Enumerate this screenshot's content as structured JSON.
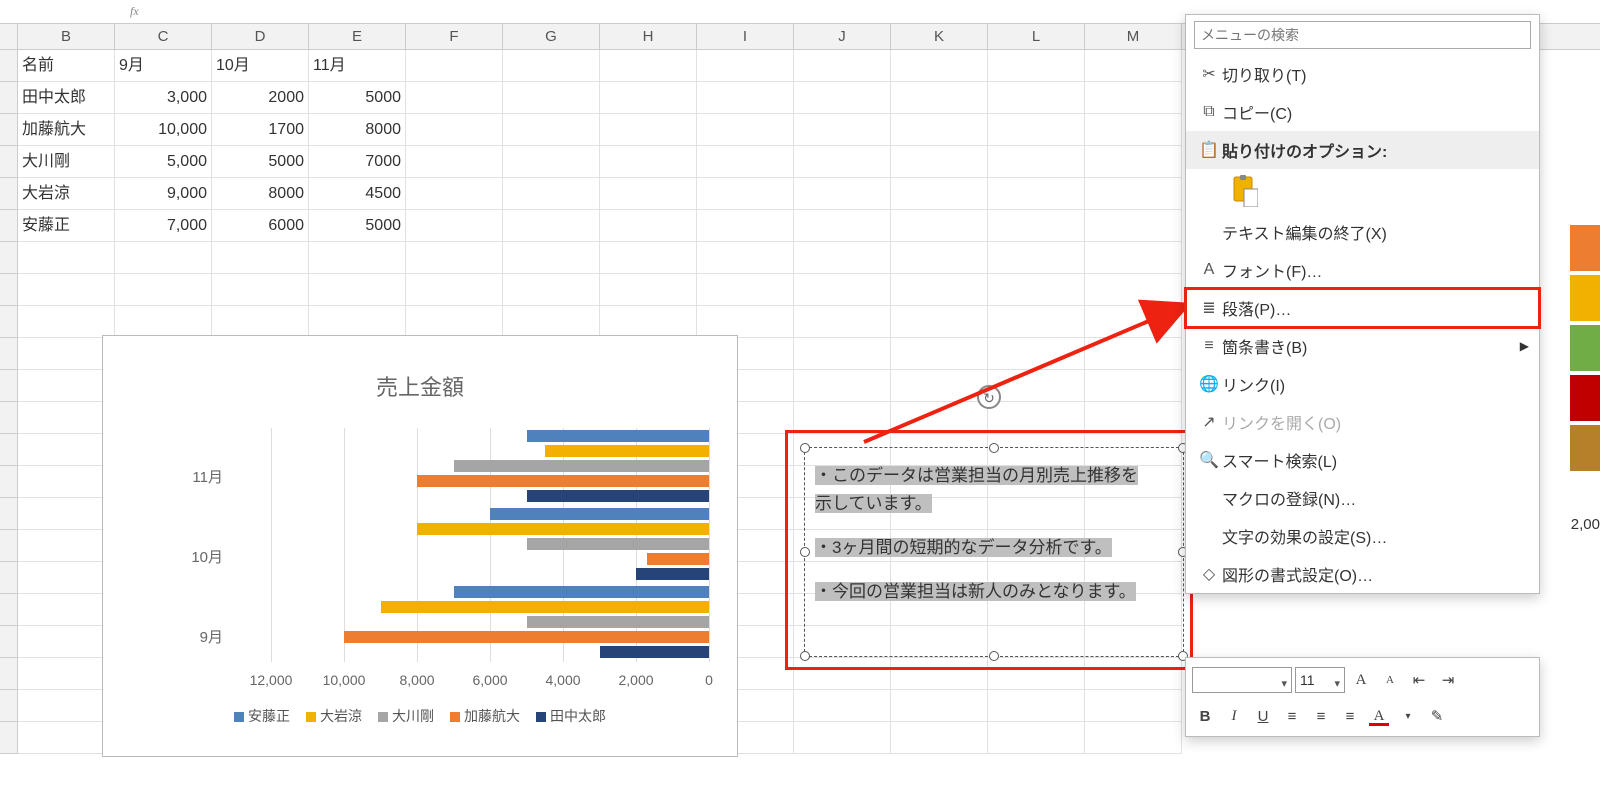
{
  "columns": [
    "B",
    "C",
    "D",
    "E",
    "F",
    "G",
    "H",
    "I",
    "J",
    "K",
    "L",
    "M"
  ],
  "table": {
    "headers": [
      "名前",
      "9月",
      "10月",
      "11月"
    ],
    "rows": [
      {
        "name": "田中太郎",
        "m9": "3,000",
        "m10": "2000",
        "m11": "5000"
      },
      {
        "name": "加藤航大",
        "m9": "10,000",
        "m10": "1700",
        "m11": "8000"
      },
      {
        "name": "大川剛",
        "m9": "5,000",
        "m10": "5000",
        "m11": "7000"
      },
      {
        "name": "大岩涼",
        "m9": "9,000",
        "m10": "8000",
        "m11": "4500"
      },
      {
        "name": "安藤正",
        "m9": "7,000",
        "m10": "6000",
        "m11": "5000"
      }
    ]
  },
  "chart_data": {
    "type": "bar",
    "orientation": "horizontal",
    "title": "売上金額",
    "categories": [
      "9月",
      "10月",
      "11月"
    ],
    "series": [
      {
        "name": "安藤正",
        "color": "#4f81bd",
        "values": [
          7000,
          6000,
          5000
        ]
      },
      {
        "name": "大岩涼",
        "color": "#f2b100",
        "values": [
          9000,
          8000,
          4500
        ]
      },
      {
        "name": "大川剛",
        "color": "#a5a5a5",
        "values": [
          5000,
          5000,
          7000
        ]
      },
      {
        "name": "加藤航大",
        "color": "#ed7d31",
        "values": [
          10000,
          1700,
          8000
        ]
      },
      {
        "name": "田中太郎",
        "color": "#264478",
        "values": [
          3000,
          2000,
          5000
        ]
      }
    ],
    "xlim": [
      12000,
      0
    ],
    "xticks": [
      "12,000",
      "10,000",
      "8,000",
      "6,000",
      "4,000",
      "2,000",
      "0"
    ]
  },
  "textbox": {
    "line1": "・このデータは営業担当の月別売上推移を",
    "line1b": "示しています。",
    "line2": "・3ヶ月間の短期的なデータ分析です。",
    "line3": "・今回の営業担当は新人のみとなります。"
  },
  "context_menu": {
    "search_placeholder": "メニューの検索",
    "cut": "切り取り(T)",
    "copy": "コピー(C)",
    "paste_header": "貼り付けのオプション:",
    "exit_text_edit": "テキスト編集の終了(X)",
    "font": "フォント(F)…",
    "paragraph": "段落(P)…",
    "bullets": "箇条書き(B)",
    "link": "リンク(I)",
    "open_link": "リンクを開く(O)",
    "smart_lookup": "スマート検索(L)",
    "assign_macro": "マクロの登録(N)…",
    "text_effects": "文字の効果の設定(S)…",
    "format_shape": "図形の書式設定(O)…"
  },
  "mini_toolbar": {
    "font_name": "",
    "font_size": "11"
  },
  "palette_colors": [
    "#ed7d31",
    "#f2b100",
    "#70ad47",
    "#c00000",
    "#b6802a"
  ],
  "extra_text": "2,00"
}
